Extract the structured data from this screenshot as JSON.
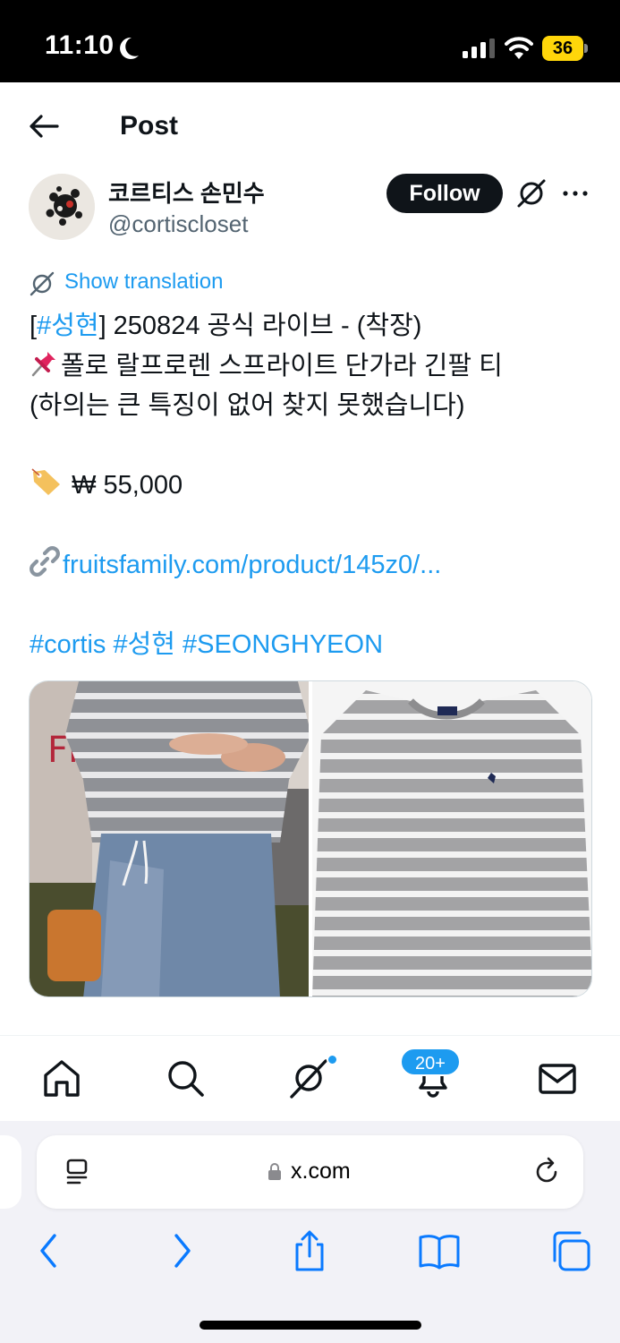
{
  "status_bar": {
    "time": "11:10",
    "battery": "36"
  },
  "header": {
    "title": "Post"
  },
  "author": {
    "name": "코르티스 손민수",
    "handle": "@cortiscloset",
    "follow_label": "Follow"
  },
  "tweet": {
    "show_translation": "Show translation",
    "line1_hashtag": "#성현",
    "line1_prefix": "[",
    "line1_rest": "] 250824 공식 라이브 - (착장)",
    "line2": "폴로 랄프로렌 스프라이트 단가라 긴팔 티",
    "line3": "(하의는 큰 특징이 없어 찾지 못했습니다)",
    "price": "₩ 55,000",
    "link": "fruitsfamily.com/product/145z0/...",
    "hashtags": "#cortis #성현 #SEONGHYEON"
  },
  "tabbar": {
    "notifications_badge": "20+"
  },
  "safari": {
    "url": "x.com"
  },
  "colors": {
    "accent": "#1d9bf0",
    "text": "#0f1419",
    "muted": "#536471",
    "battery": "#ffd60a"
  },
  "icons": [
    "moon-icon",
    "signal-icon",
    "wifi-icon",
    "back-arrow-icon",
    "grok-icon",
    "more-icon",
    "home-icon",
    "search-icon",
    "bell-icon",
    "mail-icon",
    "reader-icon",
    "lock-icon",
    "reload-icon",
    "chevron-left-icon",
    "chevron-right-icon",
    "share-icon",
    "bookmarks-icon",
    "tabs-icon"
  ]
}
